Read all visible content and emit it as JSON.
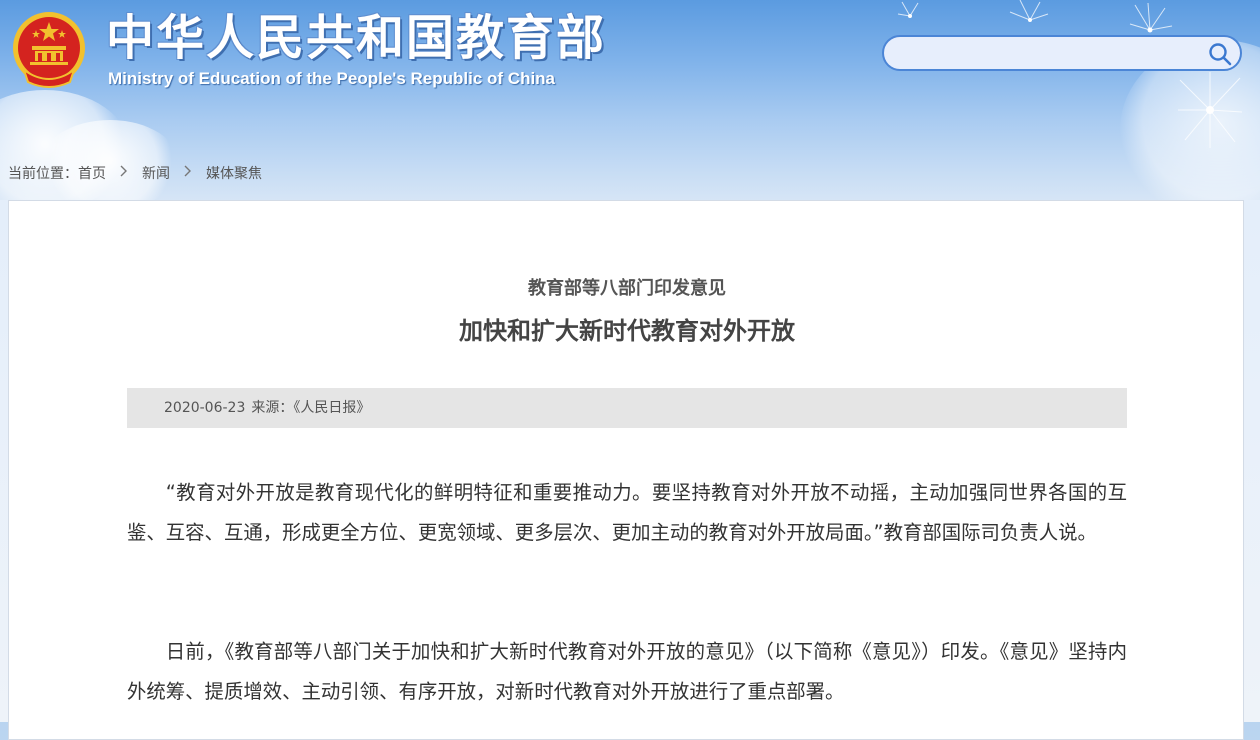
{
  "header": {
    "title": "中华人民共和国教育部",
    "subtitle": "Ministry of Education of the People's Republic of China",
    "emblem_icon": "national-emblem-icon"
  },
  "search": {
    "placeholder": "",
    "value": "",
    "icon": "search-icon"
  },
  "breadcrumb": {
    "label": "当前位置：",
    "items": [
      "首页",
      "新闻",
      "媒体聚焦"
    ],
    "separator": ">"
  },
  "article": {
    "kicker": "教育部等八部门印发意见",
    "headline": "加快和扩大新时代教育对外开放",
    "date": "2020-06-23",
    "source": "来源：《人民日报》",
    "paragraphs": [
      "“教育对外开放是教育现代化的鲜明特征和重要推动力。要坚持教育对外开放不动摇，主动加强同世界各国的互鉴、互容、互通，形成更全方位、更宽领域、更多层次、更加主动的教育对外开放局面。”教育部国际司负责人说。",
      "日前，《教育部等八部门关于加快和扩大新时代教育对外开放的意见》（以下简称《意见》）印发。《意见》坚持内外统筹、提质增效、主动引领、有序开放，对新时代教育对外开放进行了重点部署。"
    ]
  },
  "colors": {
    "header_top": "#5b9be0",
    "search_border": "#4b85d6",
    "emblem_red": "#d4231f",
    "emblem_gold": "#f2c12e",
    "meta_bar": "#e5e5e5"
  }
}
